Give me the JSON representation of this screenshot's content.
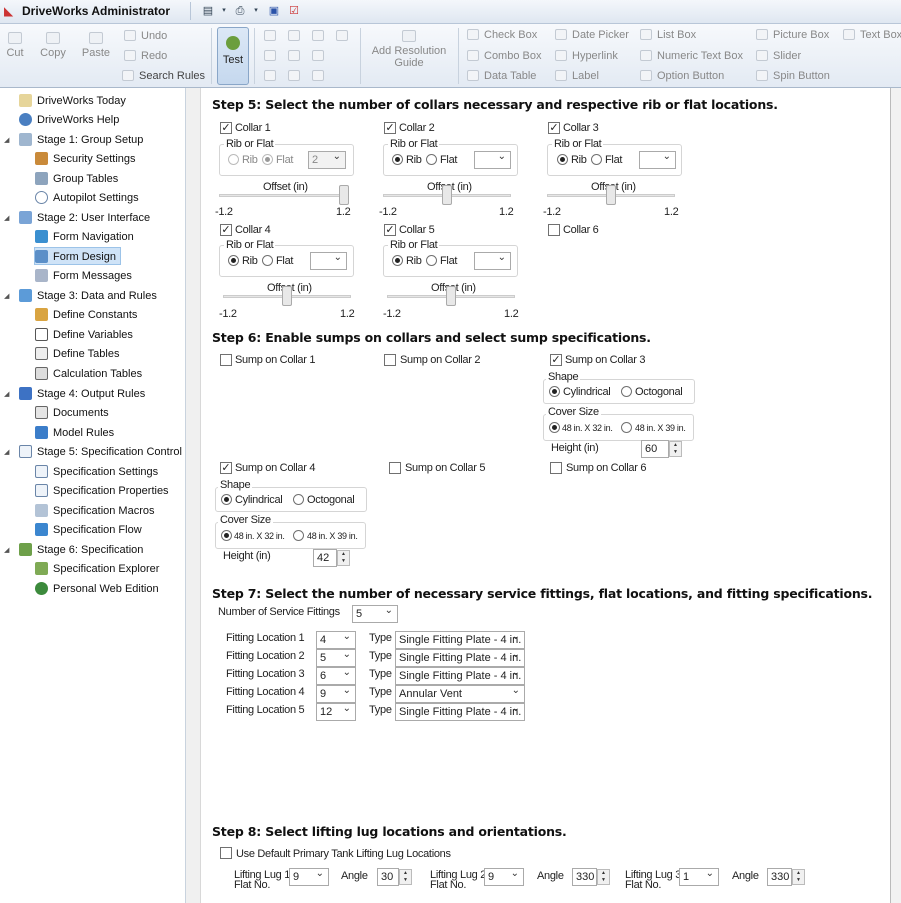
{
  "app": {
    "title": "DriveWorks Administrator"
  },
  "ribbon": {
    "cut": "Cut",
    "copy": "Copy",
    "paste": "Paste",
    "undo": "Undo",
    "redo": "Redo",
    "search_rules": "Search Rules",
    "test": "Test",
    "add_resolution_guide": "Add Resolution Guide",
    "check_box": "Check Box",
    "combo_box": "Combo Box",
    "data_table": "Data Table",
    "date_picker": "Date Picker",
    "hyperlink": "Hyperlink",
    "label": "Label",
    "list_box": "List Box",
    "numeric_text_box": "Numeric Text Box",
    "option_button": "Option Button",
    "picture_box": "Picture Box",
    "slider": "Slider",
    "spin_button": "Spin Button",
    "text_box": "Text Box"
  },
  "sidebar": {
    "items": [
      {
        "label": "DriveWorks Today"
      },
      {
        "label": "DriveWorks Help"
      },
      {
        "label": "Stage 1: Group Setup"
      },
      {
        "label": "Security Settings"
      },
      {
        "label": "Group Tables"
      },
      {
        "label": "Autopilot Settings"
      },
      {
        "label": "Stage 2: User Interface"
      },
      {
        "label": "Form Navigation"
      },
      {
        "label": "Form Design"
      },
      {
        "label": "Form Messages"
      },
      {
        "label": "Stage 3: Data and Rules"
      },
      {
        "label": "Define Constants"
      },
      {
        "label": "Define Variables"
      },
      {
        "label": "Define Tables"
      },
      {
        "label": "Calculation Tables"
      },
      {
        "label": "Stage 4: Output Rules"
      },
      {
        "label": "Documents"
      },
      {
        "label": "Model Rules"
      },
      {
        "label": "Stage 5: Specification Control"
      },
      {
        "label": "Specification Settings"
      },
      {
        "label": "Specification Properties"
      },
      {
        "label": "Specification Macros"
      },
      {
        "label": "Specification Flow"
      },
      {
        "label": "Stage 6: Specification"
      },
      {
        "label": "Specification Explorer"
      },
      {
        "label": "Personal Web Edition"
      }
    ]
  },
  "form": {
    "step5": {
      "heading": "Step 5: Select the number of collars necessary and respective rib or flat locations.",
      "group_label": "Rib or Flat",
      "rib": "Rib",
      "flat": "Flat",
      "offset": "Offset (in)",
      "min": "-1.2",
      "max": "1.2",
      "collars": [
        {
          "label": "Collar 1",
          "checked": true,
          "value": "2"
        },
        {
          "label": "Collar 2",
          "checked": true,
          "value": ""
        },
        {
          "label": "Collar 3",
          "checked": true,
          "value": ""
        },
        {
          "label": "Collar 4",
          "checked": true,
          "value": ""
        },
        {
          "label": "Collar 5",
          "checked": true,
          "value": ""
        },
        {
          "label": "Collar 6",
          "checked": false
        }
      ]
    },
    "step6": {
      "heading": "Step 6: Enable sumps on collars and select sump specifications.",
      "sumps": [
        "Sump on Collar 1",
        "Sump on Collar 2",
        "Sump on Collar 3",
        "Sump on Collar 4",
        "Sump on Collar 5",
        "Sump on Collar 6"
      ],
      "shape": "Shape",
      "cylindrical": "Cylindrical",
      "octogonal": "Octogonal",
      "cover_size": "Cover Size",
      "cover_a": "48 in. X 32 in.",
      "cover_b": "48 in. X 39 in.",
      "height": "Height (in)",
      "height3": "60",
      "height4": "42"
    },
    "step7": {
      "heading": "Step 7: Select the number of necessary service fittings, flat locations, and fitting specifications.",
      "count_label": "Number of Service Fittings",
      "count": "5",
      "type_label": "Type",
      "fittings": [
        {
          "label": "Fitting Location 1",
          "loc": "4",
          "type": "Single Fitting Plate - 4 in."
        },
        {
          "label": "Fitting Location 2",
          "loc": "5",
          "type": "Single Fitting Plate - 4 in."
        },
        {
          "label": "Fitting Location 3",
          "loc": "6",
          "type": "Single Fitting Plate - 4 in."
        },
        {
          "label": "Fitting Location 4",
          "loc": "9",
          "type": "Annular Vent"
        },
        {
          "label": "Fitting Location 5",
          "loc": "12",
          "type": "Single Fitting Plate - 4 in."
        }
      ]
    },
    "step8": {
      "heading": "Step 8: Select lifting lug locations and orientations.",
      "default_label": "Use Default Primary Tank Lifting Lug Locations",
      "angle_label": "Angle",
      "lugs": [
        {
          "label1": "Lifting Lug 1",
          "label2": "Flat No.",
          "flat": "9",
          "angle": "30"
        },
        {
          "label1": "Lifting Lug 2",
          "label2": "Flat No.",
          "flat": "9",
          "angle": "330"
        },
        {
          "label1": "Lifting Lug 3",
          "label2": "Flat No.",
          "flat": "1",
          "angle": "330"
        }
      ]
    }
  }
}
